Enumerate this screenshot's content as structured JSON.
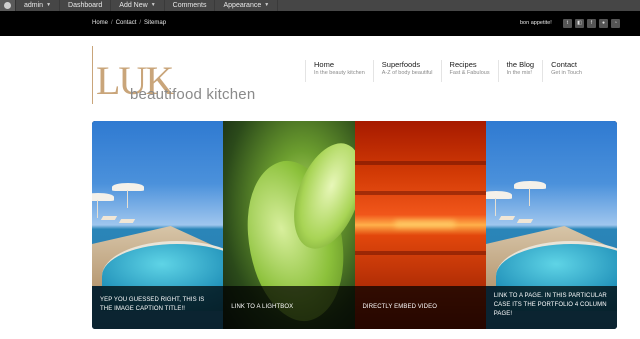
{
  "adminbar": {
    "items": [
      {
        "label": "admin",
        "caret": true
      },
      {
        "label": "Dashboard",
        "caret": false
      },
      {
        "label": "Add New",
        "caret": true
      },
      {
        "label": "Comments",
        "caret": false
      },
      {
        "label": "Appearance",
        "caret": true
      }
    ]
  },
  "topbar": {
    "breadcrumb": [
      "Home",
      "Contact",
      "Sitemap"
    ],
    "separator": "/",
    "tagline": "bon appetite!",
    "social": [
      "twitter-icon",
      "delicious-icon",
      "facebook-icon",
      "flickr-icon",
      "rss-icon"
    ]
  },
  "logo": {
    "mark": "LUK",
    "text": "beautifood kitchen",
    "color": "#c9a57a"
  },
  "nav": [
    {
      "title": "Home",
      "sub": "In the beauty kitchen"
    },
    {
      "title": "Superfoods",
      "sub": "A-Z of body beautiful"
    },
    {
      "title": "Recipes",
      "sub": "Fast & Fabulous"
    },
    {
      "title": "the Blog",
      "sub": "In the mix!"
    },
    {
      "title": "Contact",
      "sub": "Get in Touch"
    }
  ],
  "slider": {
    "panels": [
      {
        "caption": "YEP YOU GUESSED RIGHT, THIS IS THE IMAGE CAPTION TITLE!!"
      },
      {
        "caption": "LINK TO A LIGHTBOX"
      },
      {
        "caption": "DIRECTLY EMBED VIDEO"
      },
      {
        "caption": "LINK TO A PAGE. IN THIS PARTICULAR CASE ITS THE PORTFOLIO 4 COLUMN PAGE!"
      }
    ]
  }
}
